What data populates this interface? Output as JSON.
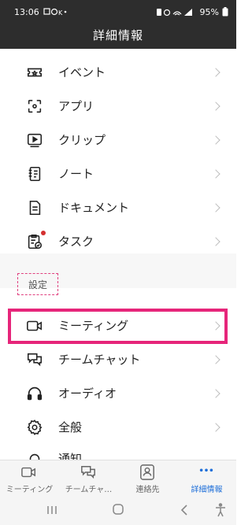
{
  "status": {
    "time": "13:06",
    "battery": "95%"
  },
  "header": {
    "title": "詳細情報"
  },
  "menu": [
    {
      "label": "イベント",
      "icon": "ticket-icon"
    },
    {
      "label": "アプリ",
      "icon": "apps-icon"
    },
    {
      "label": "クリップ",
      "icon": "clip-play-icon"
    },
    {
      "label": "ノート",
      "icon": "notebook-icon"
    },
    {
      "label": "ドキュメント",
      "icon": "document-icon"
    },
    {
      "label": "タスク",
      "icon": "task-clipboard-icon"
    }
  ],
  "settings": {
    "section_label": "設定",
    "items": [
      {
        "label": "ミーティング",
        "icon": "video-camera-icon"
      },
      {
        "label": "チームチャット",
        "icon": "chat-bubbles-icon"
      },
      {
        "label": "オーディオ",
        "icon": "headphones-icon"
      },
      {
        "label": "全般",
        "icon": "gear-icon"
      },
      {
        "label": "通知",
        "icon": "bell-icon"
      }
    ]
  },
  "bottom_nav": [
    {
      "label": "ミーティング",
      "icon": "video-camera-icon"
    },
    {
      "label": "チームチャ…",
      "icon": "chat-bubbles-icon"
    },
    {
      "label": "連絡先",
      "icon": "contact-card-icon"
    },
    {
      "label": "詳細情報",
      "icon": "more-dots-icon",
      "active": true
    }
  ],
  "colors": {
    "header_bg": "#2d2d2d",
    "accent": "#1e6fd9",
    "highlight": "#e6257a"
  }
}
